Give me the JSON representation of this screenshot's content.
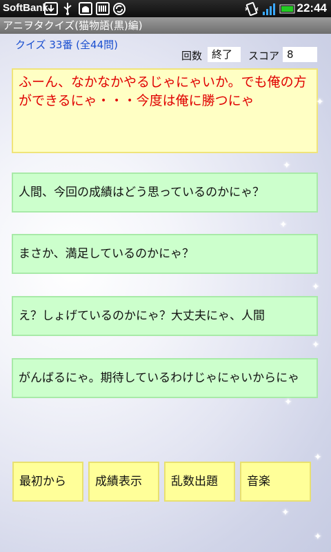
{
  "status_bar": {
    "carrier": "SoftBank",
    "time": "22:44"
  },
  "title": "アニヲタクイズ(猫物語(黒)編)",
  "quiz_number": "クイズ 33番 (全44問)",
  "stats": {
    "count_label": "回数",
    "count_value": "終了",
    "score_label": "スコア",
    "score_value": "8"
  },
  "question": "ふーん、なかなかやるじゃにゃいか。でも俺の方ができるにゃ・・・今度は俺に勝つにゃ",
  "choices": [
    "人間、今回の成績はどう思っているのかにゃ？",
    "まさか、満足しているのかにゃ？",
    "え？しょげているのかにゃ？大丈夫にゃ、人間",
    "がんばるにゃ。期待しているわけじゃにゃいからにゃ"
  ],
  "buttons": [
    "最初から",
    "成績表示",
    "乱数出題",
    "音楽"
  ],
  "colors": {
    "question_bg": "#ffffc4",
    "question_text": "#e00000",
    "choice_bg": "#ccffcc",
    "button_bg": "#ffff99",
    "quiz_number_text": "#1a4fd0"
  }
}
